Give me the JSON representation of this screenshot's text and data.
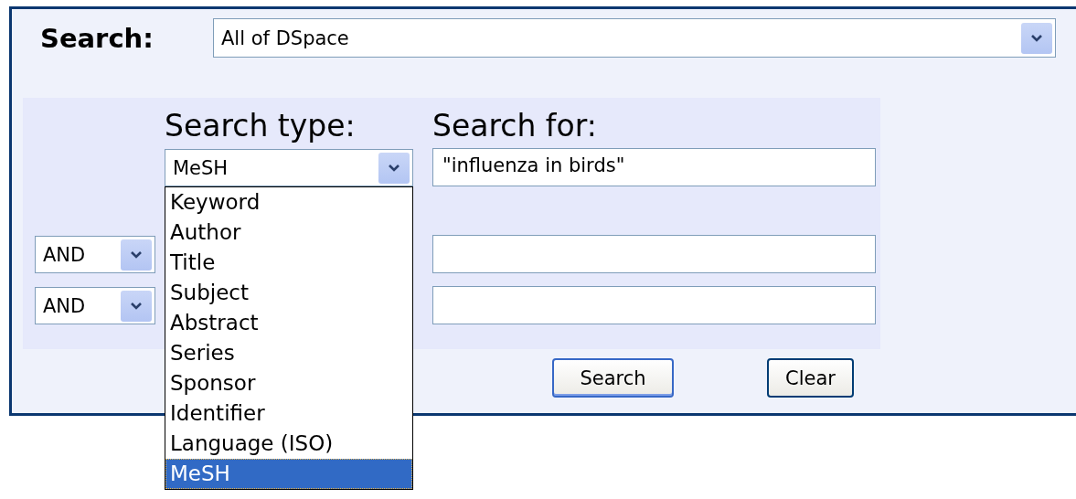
{
  "scope": {
    "label": "Search:",
    "value": "All of DSpace"
  },
  "headings": {
    "type": "Search type:",
    "query": "Search for:"
  },
  "first_row": {
    "type_value": "MeSH",
    "query_value": "\"influenza in birds\""
  },
  "type_options": [
    {
      "label": "Keyword",
      "selected": false
    },
    {
      "label": "Author",
      "selected": false
    },
    {
      "label": "Title",
      "selected": false
    },
    {
      "label": "Subject",
      "selected": false
    },
    {
      "label": "Abstract",
      "selected": false
    },
    {
      "label": "Series",
      "selected": false
    },
    {
      "label": "Sponsor",
      "selected": false
    },
    {
      "label": "Identifier",
      "selected": false
    },
    {
      "label": "Language (ISO)",
      "selected": false
    },
    {
      "label": "MeSH",
      "selected": true
    }
  ],
  "extra_rows": [
    {
      "conjunction": "AND"
    },
    {
      "conjunction": "AND"
    }
  ],
  "buttons": [
    {
      "label": "Search",
      "default": true
    },
    {
      "label": "Clear",
      "default": false
    }
  ]
}
